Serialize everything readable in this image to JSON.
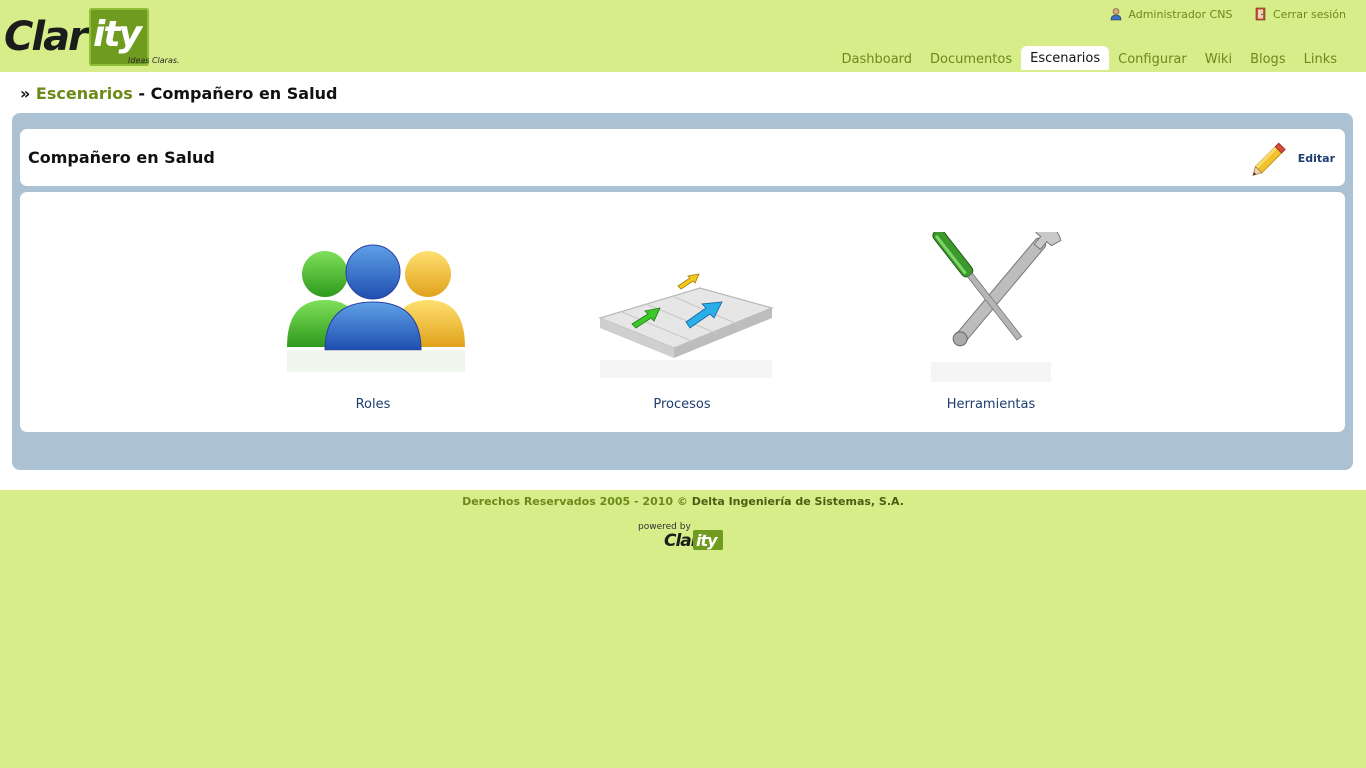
{
  "brand": {
    "logo_a": "Clar",
    "logo_b": "ity",
    "tagline": "Ideas Claras.",
    "accent": "#6f9b1f",
    "background": "#d6ed8a"
  },
  "userbar": {
    "user_label": "Administrador CNS",
    "logout_label": "Cerrar sesión"
  },
  "nav": {
    "tabs": [
      {
        "label": "Dashboard"
      },
      {
        "label": "Documentos"
      },
      {
        "label": "Escenarios"
      },
      {
        "label": "Configurar"
      },
      {
        "label": "Wiki"
      },
      {
        "label": "Blogs"
      },
      {
        "label": "Links"
      }
    ],
    "active": "Escenarios"
  },
  "breadcrumb": {
    "prefix": "»",
    "link": "Escenarios",
    "separator": "-",
    "current": "Compañero en Salud"
  },
  "scenario": {
    "title": "Compañero en Salud",
    "edit_label": "Editar"
  },
  "items": [
    {
      "label": "Roles",
      "icon": "people-icon"
    },
    {
      "label": "Procesos",
      "icon": "process-arrows-icon"
    },
    {
      "label": "Herramientas",
      "icon": "tools-icon"
    }
  ],
  "footer": {
    "rights": "Derechos Reservados 2005 - 2010 ©",
    "company": "Delta Ingeniería de Sistemas, S.A.",
    "powered_by": "powered by",
    "powered_logo_a": "Clar",
    "powered_logo_b": "ity"
  }
}
